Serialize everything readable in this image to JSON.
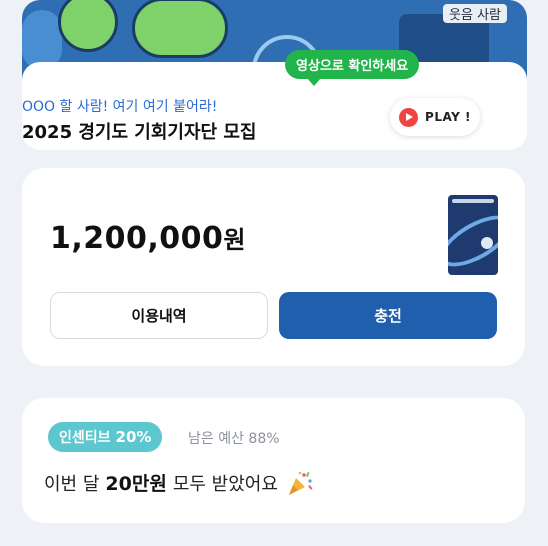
{
  "banner": {
    "corner_text": "웃음 사람",
    "tooltip": "영상으로 확인하세요",
    "subtitle": "OOO 할 사람! 여기 여기 붙어라!",
    "title": "2025 경기도 기회기자단 모집",
    "play_label": "PLAY !"
  },
  "balance": {
    "amount": "1,200,000",
    "unit": "원",
    "history_button": "이용내역",
    "charge_button": "충전"
  },
  "incentive": {
    "badge_label": "인센티브",
    "badge_rate": "20%",
    "remaining_budget": "남은 예산 88%",
    "month_prefix": "이번 달",
    "month_amount": "20만원",
    "month_suffix": "모두 받았어요"
  },
  "colors": {
    "primary": "#1f5fae",
    "accent_green": "#21b44b",
    "badge_teal": "#5cc7cf",
    "link_blue": "#2b6bd6",
    "play_red": "#ef4444"
  },
  "icons": {
    "play": "play-icon",
    "celebration": "party-popper-icon"
  }
}
